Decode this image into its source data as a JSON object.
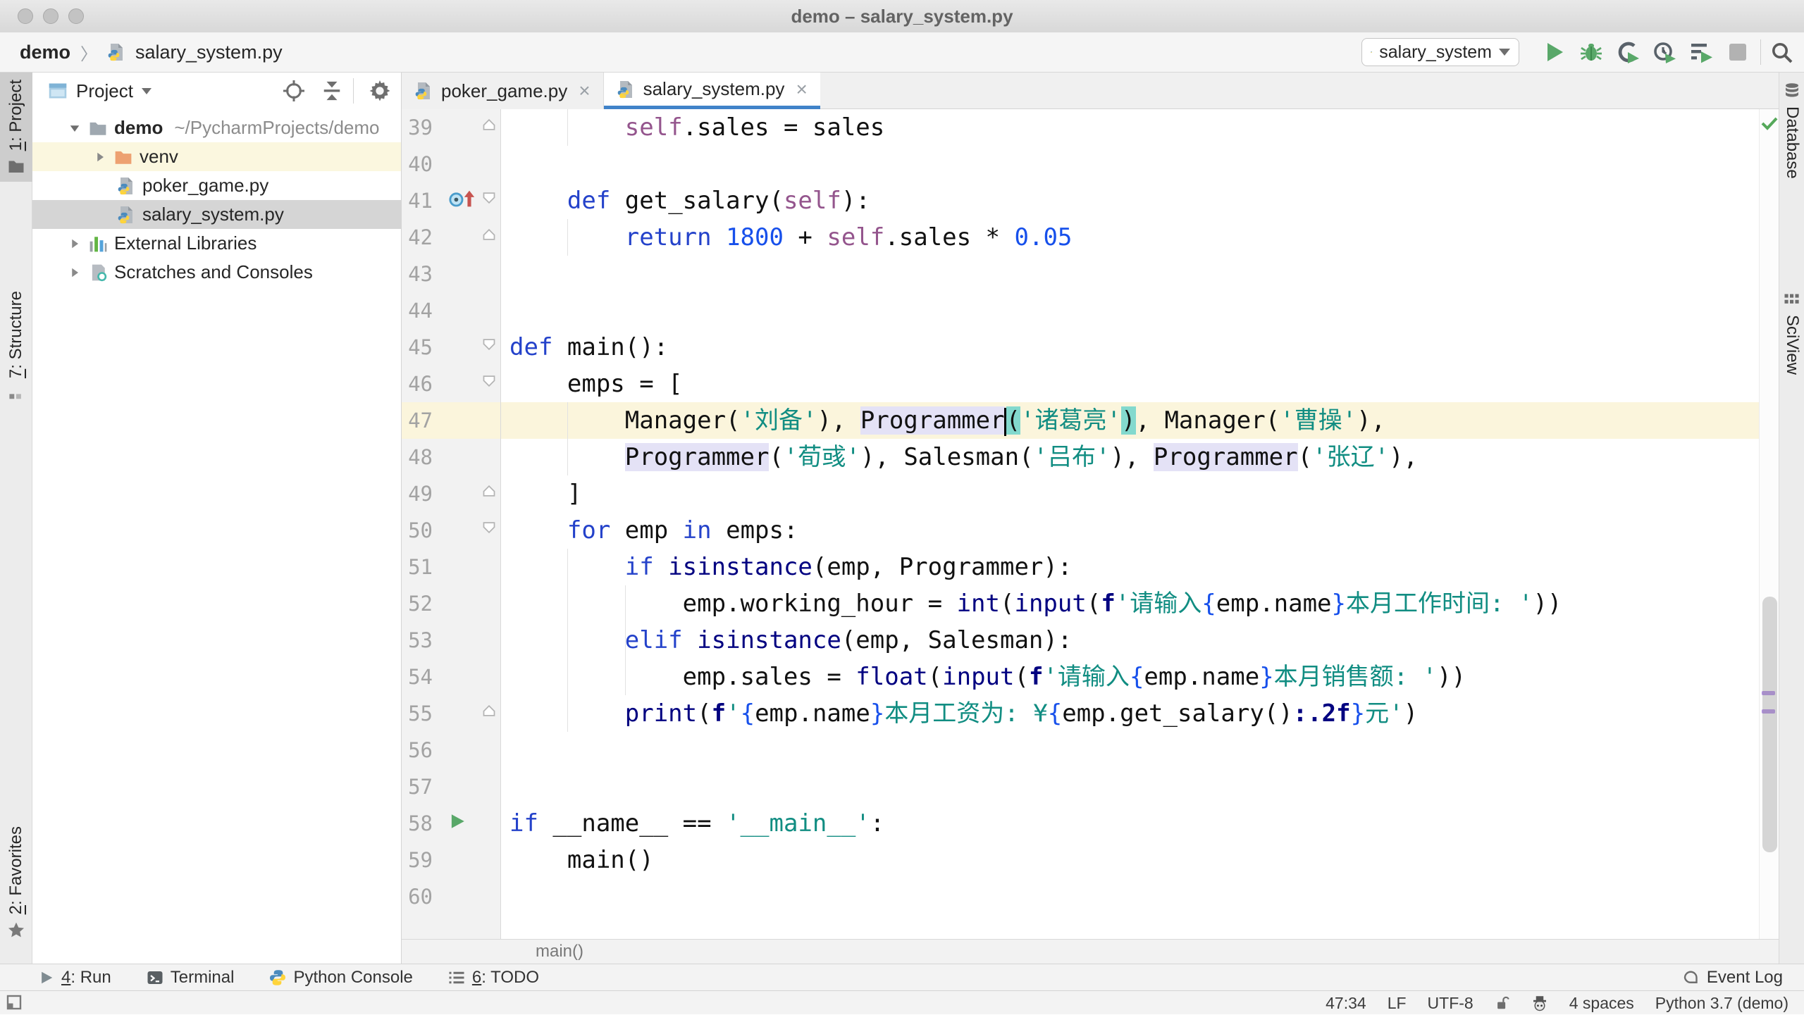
{
  "window": {
    "title": "demo – salary_system.py"
  },
  "breadcrumb": {
    "project": "demo",
    "file": "salary_system.py"
  },
  "run_toolbar": {
    "config_name": "salary_system",
    "icons": [
      "run",
      "debug",
      "run-with-coverage",
      "profiler",
      "run-concurrency",
      "stop",
      "search"
    ]
  },
  "left_bar": {
    "project": {
      "mn": "1",
      "rest": ": Project"
    },
    "structure": {
      "mn": "7",
      "rest": ": Structure"
    },
    "favorites": {
      "mn": "2",
      "rest": ": Favorites"
    }
  },
  "project_panel": {
    "header": "Project",
    "tree": {
      "demo": {
        "name": "demo",
        "path": "~/PycharmProjects/demo"
      },
      "venv": {
        "name": "venv"
      },
      "poker": {
        "name": "poker_game.py"
      },
      "salary": {
        "name": "salary_system.py"
      },
      "external": {
        "name": "External Libraries"
      },
      "scratches": {
        "name": "Scratches and Consoles"
      }
    }
  },
  "tabs": {
    "inactive": "poker_game.py",
    "active": "salary_system.py",
    "close": "×"
  },
  "editor": {
    "footer_breadcrumb": "main()",
    "guides": [
      {
        "col": 4,
        "from": 39,
        "to": 39
      },
      {
        "col": 4,
        "from": 42,
        "to": 42
      },
      {
        "col": 4,
        "from": 47,
        "to": 48
      },
      {
        "col": 4,
        "from": 51,
        "to": 55
      },
      {
        "col": 8,
        "from": 52,
        "to": 54
      }
    ],
    "lines": [
      {
        "n": 39,
        "fold": "up",
        "tokens": [
          [
            "p",
            "        "
          ],
          [
            "self",
            "self"
          ],
          [
            "p",
            ".sales = sales"
          ]
        ]
      },
      {
        "n": 40,
        "tokens": []
      },
      {
        "n": 41,
        "fold": "down",
        "icon": "override",
        "tokens": [
          [
            "p",
            "    "
          ],
          [
            "kw",
            "def "
          ],
          [
            "p",
            "get_salary("
          ],
          [
            "self",
            "self"
          ],
          [
            "p",
            "):"
          ]
        ]
      },
      {
        "n": 42,
        "fold": "up",
        "tokens": [
          [
            "p",
            "        "
          ],
          [
            "kw",
            "return "
          ],
          [
            "num",
            "1800"
          ],
          [
            "p",
            " + "
          ],
          [
            "self",
            "self"
          ],
          [
            "p",
            ".sales * "
          ],
          [
            "num",
            "0.05"
          ]
        ]
      },
      {
        "n": 43,
        "tokens": []
      },
      {
        "n": 44,
        "tokens": []
      },
      {
        "n": 45,
        "fold": "down",
        "tokens": [
          [
            "kw",
            "def "
          ],
          [
            "p",
            "main():"
          ]
        ]
      },
      {
        "n": 46,
        "fold": "down",
        "tokens": [
          [
            "p",
            "    emps = ["
          ]
        ]
      },
      {
        "n": 47,
        "current": true,
        "tokens": [
          [
            "p",
            "        Manager("
          ],
          [
            "str",
            "'刘备'"
          ],
          [
            "p",
            "), "
          ],
          [
            "hid",
            "Programmer"
          ],
          [
            "caret",
            ""
          ],
          [
            "hpar",
            "("
          ],
          [
            "str",
            "'诸葛亮'"
          ],
          [
            "hpar",
            ")"
          ],
          [
            "p",
            ", Manager("
          ],
          [
            "str",
            "'曹操'"
          ],
          [
            "p",
            "),"
          ]
        ]
      },
      {
        "n": 48,
        "tokens": [
          [
            "p",
            "        "
          ],
          [
            "hid",
            "Programmer"
          ],
          [
            "p",
            "("
          ],
          [
            "str",
            "'荀彧'"
          ],
          [
            "p",
            "), Salesman("
          ],
          [
            "str",
            "'吕布'"
          ],
          [
            "p",
            "), "
          ],
          [
            "hid",
            "Programmer"
          ],
          [
            "p",
            "("
          ],
          [
            "str",
            "'张辽'"
          ],
          [
            "p",
            "),"
          ]
        ]
      },
      {
        "n": 49,
        "fold": "up",
        "tokens": [
          [
            "p",
            "    ]"
          ]
        ]
      },
      {
        "n": 50,
        "fold": "down",
        "tokens": [
          [
            "p",
            "    "
          ],
          [
            "kw",
            "for "
          ],
          [
            "p",
            "emp "
          ],
          [
            "kw",
            "in "
          ],
          [
            "p",
            "emps:"
          ]
        ]
      },
      {
        "n": 51,
        "tokens": [
          [
            "p",
            "        "
          ],
          [
            "kw",
            "if "
          ],
          [
            "bi",
            "isinstance"
          ],
          [
            "p",
            "(emp, Programmer):"
          ]
        ]
      },
      {
        "n": 52,
        "tokens": [
          [
            "p",
            "            emp.working_hour = "
          ],
          [
            "bi",
            "int"
          ],
          [
            "p",
            "("
          ],
          [
            "bi",
            "input"
          ],
          [
            "p",
            "("
          ],
          [
            "fmt",
            "f"
          ],
          [
            "str",
            "'请输入"
          ],
          [
            "br",
            "{"
          ],
          [
            "p",
            "emp.name"
          ],
          [
            "br",
            "}"
          ],
          [
            "str",
            "本月工作时间: '"
          ],
          [
            "p",
            "))"
          ]
        ]
      },
      {
        "n": 53,
        "tokens": [
          [
            "p",
            "        "
          ],
          [
            "kw",
            "elif "
          ],
          [
            "bi",
            "isinstance"
          ],
          [
            "p",
            "(emp, Salesman):"
          ]
        ]
      },
      {
        "n": 54,
        "tokens": [
          [
            "p",
            "            emp.sales = "
          ],
          [
            "bi",
            "float"
          ],
          [
            "p",
            "("
          ],
          [
            "bi",
            "input"
          ],
          [
            "p",
            "("
          ],
          [
            "fmt",
            "f"
          ],
          [
            "str",
            "'请输入"
          ],
          [
            "br",
            "{"
          ],
          [
            "p",
            "emp.name"
          ],
          [
            "br",
            "}"
          ],
          [
            "str",
            "本月销售额: '"
          ],
          [
            "p",
            "))"
          ]
        ]
      },
      {
        "n": 55,
        "fold": "up",
        "tokens": [
          [
            "p",
            "        "
          ],
          [
            "bi",
            "print"
          ],
          [
            "p",
            "("
          ],
          [
            "fmt",
            "f"
          ],
          [
            "str",
            "'"
          ],
          [
            "br",
            "{"
          ],
          [
            "p",
            "emp.name"
          ],
          [
            "br",
            "}"
          ],
          [
            "str",
            "本月工资为: ¥"
          ],
          [
            "br",
            "{"
          ],
          [
            "p",
            "emp.get_salary()"
          ],
          [
            "fmt",
            ":.2f"
          ],
          [
            "br",
            "}"
          ],
          [
            "str",
            "元'"
          ],
          [
            "p",
            ")"
          ]
        ]
      },
      {
        "n": 56,
        "tokens": []
      },
      {
        "n": 57,
        "tokens": []
      },
      {
        "n": 58,
        "icon": "run",
        "tokens": [
          [
            "kw",
            "if "
          ],
          [
            "p",
            "__name__ == "
          ],
          [
            "str",
            "'__main__'"
          ],
          [
            "p",
            ":"
          ]
        ]
      },
      {
        "n": 59,
        "tokens": [
          [
            "p",
            "    main()"
          ]
        ]
      },
      {
        "n": 60,
        "tokens": []
      }
    ]
  },
  "right_bar": {
    "database": "Database",
    "sciview": "SciView"
  },
  "bottom_bar": {
    "run": {
      "mn": "4",
      "rest": ": Run"
    },
    "terminal": "Terminal",
    "python_console": "Python Console",
    "todo": {
      "mn": "6",
      "rest": ": TODO"
    },
    "event_log": "Event Log"
  },
  "status_bar": {
    "caret_position": "47:34",
    "line_separator": "LF",
    "encoding": "UTF-8",
    "indent": "4 spaces",
    "interpreter": "Python 3.7 (demo)"
  },
  "palette": {
    "accent_blue": "#4083C9",
    "run_green": "#59A869",
    "keyword_blue": "#2442CA",
    "number_blue": "#1750EB",
    "builtin_navy": "#000080",
    "self_purple": "#94558D",
    "string_teal": "#118D82",
    "caret_row": "#FBF5DC",
    "selected_row": "#D5D5D5",
    "venv_row": "#FBF7DF",
    "identifier_highlight": "#E4E2F6",
    "brace_match": "#83D9CE"
  }
}
